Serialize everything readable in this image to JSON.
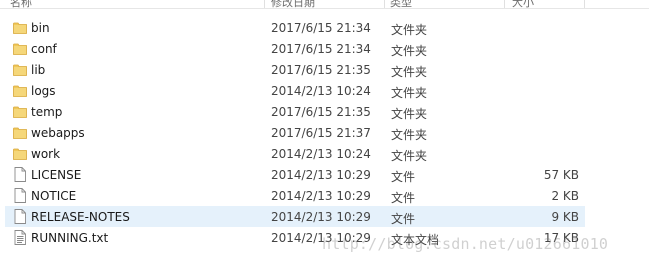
{
  "header": {
    "columns": [
      "名称",
      "修改日期",
      "类型",
      "大小"
    ]
  },
  "files": [
    {
      "name": "bin",
      "date": "2017/6/15 21:34",
      "type": "文件夹",
      "size": "",
      "icon": "folder-icon"
    },
    {
      "name": "conf",
      "date": "2017/6/15 21:34",
      "type": "文件夹",
      "size": "",
      "icon": "folder-icon"
    },
    {
      "name": "lib",
      "date": "2017/6/15 21:35",
      "type": "文件夹",
      "size": "",
      "icon": "folder-icon"
    },
    {
      "name": "logs",
      "date": "2014/2/13 10:24",
      "type": "文件夹",
      "size": "",
      "icon": "folder-icon"
    },
    {
      "name": "temp",
      "date": "2017/6/15 21:35",
      "type": "文件夹",
      "size": "",
      "icon": "folder-icon"
    },
    {
      "name": "webapps",
      "date": "2017/6/15 21:37",
      "type": "文件夹",
      "size": "",
      "icon": "folder-icon"
    },
    {
      "name": "work",
      "date": "2014/2/13 10:24",
      "type": "文件夹",
      "size": "",
      "icon": "folder-icon"
    },
    {
      "name": "LICENSE",
      "date": "2014/2/13 10:29",
      "type": "文件",
      "size": "57 KB",
      "icon": "file-icon"
    },
    {
      "name": "NOTICE",
      "date": "2014/2/13 10:29",
      "type": "文件",
      "size": "2 KB",
      "icon": "file-icon"
    },
    {
      "name": "RELEASE-NOTES",
      "date": "2014/2/13 10:29",
      "type": "文件",
      "size": "9 KB",
      "icon": "file-icon",
      "selected": true
    },
    {
      "name": "RUNNING.txt",
      "date": "2014/2/13 10:29",
      "type": "文本文档",
      "size": "17 KB",
      "icon": "text-file-icon"
    }
  ],
  "watermark": "http://blog.csdn.net/u012661010",
  "colors": {
    "folder": "#e8b84a",
    "selection": "#e5f1fb"
  }
}
